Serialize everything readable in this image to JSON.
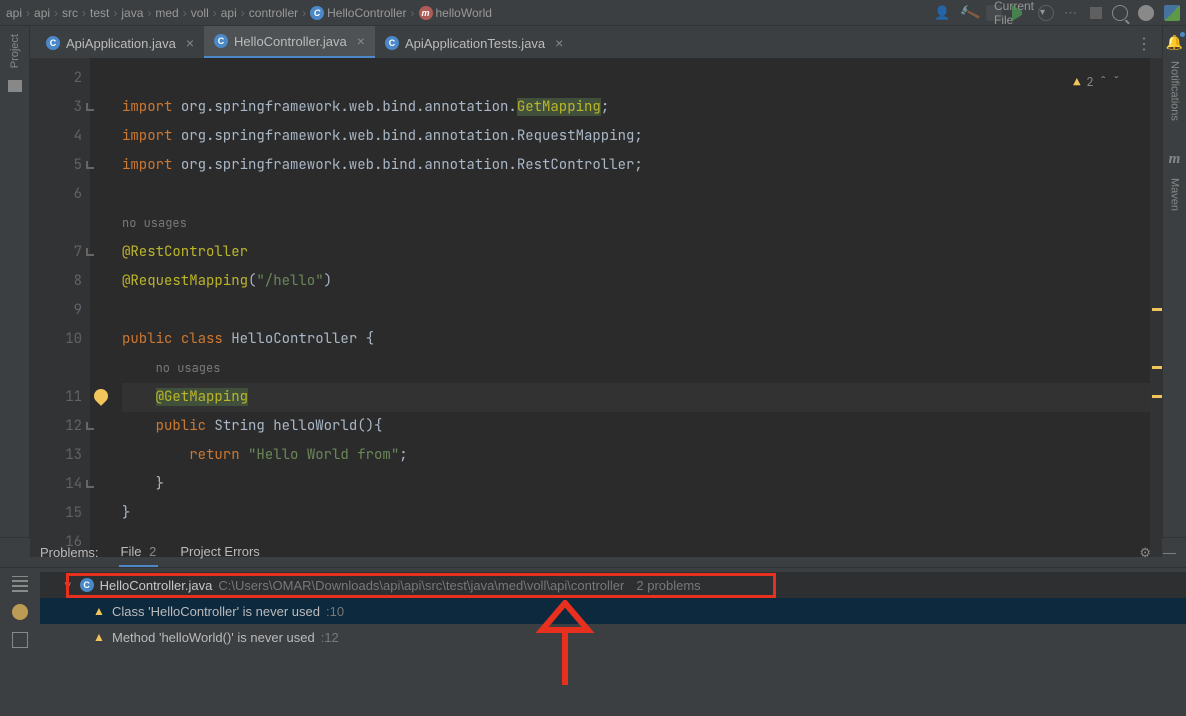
{
  "breadcrumbs": [
    "api",
    "api",
    "src",
    "test",
    "java",
    "med",
    "voll",
    "api",
    "controller",
    "HelloController",
    "helloWorld"
  ],
  "toolbar": {
    "runconfig": "Current File"
  },
  "tabs": [
    {
      "label": "ApiApplication.java"
    },
    {
      "label": "HelloController.java"
    },
    {
      "label": "ApiApplicationTests.java"
    }
  ],
  "editor": {
    "warnings_count": "2",
    "no_usages": "no usages",
    "lines": {
      "l2": [
        "import ",
        "org.springframework.web.bind.annotation.",
        "GetMapping",
        ";"
      ],
      "l3": [
        "import ",
        "org.springframework.web.bind.annotation.",
        "RequestMapping",
        ";"
      ],
      "l4": [
        "import ",
        "org.springframework.web.bind.annotation.",
        "RestController",
        ";"
      ],
      "l7": [
        "@RestController"
      ],
      "l8": [
        "@RequestMapping",
        "(",
        "\"/hello\"",
        ")"
      ],
      "l10": [
        "public ",
        "class ",
        "HelloController",
        " {"
      ],
      "l11": [
        "@GetMapping"
      ],
      "l12": [
        "public ",
        "String ",
        "helloWorld",
        "(){"
      ],
      "l13": [
        "return ",
        "\"Hello World from\"",
        ";"
      ],
      "l14": "}",
      "l15": "}"
    }
  },
  "leftRail": "Project",
  "rightRail": {
    "notifications": "Notifications",
    "maven": "Maven"
  },
  "problems": {
    "title": "Problems:",
    "tab_file": "File",
    "tab_file_count": "2",
    "tab_errors": "Project Errors",
    "file": "HelloController.java",
    "path": "C:\\Users\\OMAR\\Downloads\\api\\api\\src\\test\\java\\med\\voll\\api\\controller",
    "count": "2 problems",
    "items": [
      {
        "msg": "Class 'HelloController' is never used",
        "loc": ":10"
      },
      {
        "msg": "Method 'helloWorld()' is never used",
        "loc": ":12"
      }
    ]
  }
}
